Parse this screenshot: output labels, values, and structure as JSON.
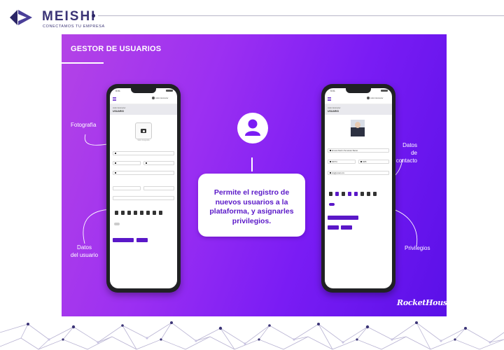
{
  "brand": {
    "name": "MEISHI",
    "tagline": "CONECTAMOS TU EMPRESA",
    "colors": {
      "primary": "#3b3476",
      "accent": "#2b2566"
    },
    "icon": "meishi-logo-icon"
  },
  "slide": {
    "title": "GESTOR DE USUARIOS",
    "gradient": [
      "#b443e6",
      "#7a1cf4",
      "#5a10e8"
    ],
    "center_card": {
      "icon": "user-icon",
      "text": "Permite el registro de nuevos usuarios a la plataforma, y asignarles privilegios."
    },
    "callouts": {
      "fotografia": "Fotografía",
      "datos_usuario": "Datos\ndel usuario",
      "datos_contacto": "Datos\nde contacto",
      "privilegios": "Privilegios"
    },
    "watermark": "RocketHouse"
  },
  "phone_left": {
    "time": "5:01",
    "user": "Administrador",
    "breadcrumb": "Administrador",
    "page_title": "USUARIO",
    "photo_caption": "Subir fotografía",
    "icon": "camera-icon"
  },
  "phone_right": {
    "time": "5:01",
    "user": "Administrador",
    "breadcrumb": "Administrador",
    "page_title": "USUARIO",
    "name_value": "Ernesto Martín Hernández Bazán",
    "phone_value": "668 54",
    "ext_value": "6685",
    "email_value": "ehg@email.com"
  }
}
